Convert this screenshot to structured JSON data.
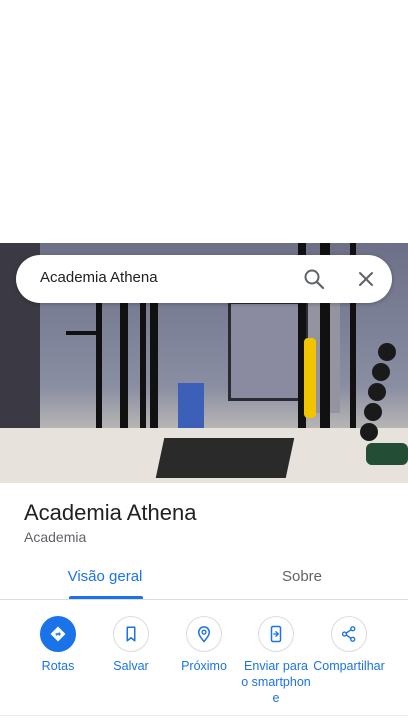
{
  "search": {
    "query": "Academia Athena"
  },
  "place": {
    "name": "Academia Athena",
    "category": "Academia"
  },
  "tabs": [
    {
      "label": "Visão geral",
      "active": true
    },
    {
      "label": "Sobre",
      "active": false
    }
  ],
  "actions": [
    {
      "label": "Rotas",
      "icon": "directions-icon"
    },
    {
      "label": "Salvar",
      "icon": "bookmark-icon"
    },
    {
      "label": "Próximo",
      "icon": "nearby-icon"
    },
    {
      "label": "Enviar para o smartphone",
      "icon": "send-to-phone-icon"
    },
    {
      "label": "Compartilhar",
      "icon": "share-icon"
    }
  ],
  "colors": {
    "accent": "#1a73e8",
    "text_primary": "#202124",
    "text_secondary": "#5f6368"
  }
}
